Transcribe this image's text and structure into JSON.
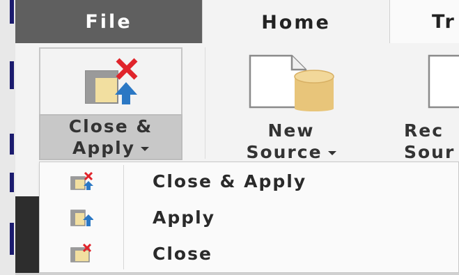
{
  "tabs": [
    {
      "label": "File",
      "active": false
    },
    {
      "label": "Home",
      "active": true
    },
    {
      "label": "Tr",
      "active": false
    }
  ],
  "ribbon": {
    "close_apply": {
      "line1": "Close &",
      "line2": "Apply",
      "icon": "close-apply-icon",
      "has_dropdown": true
    },
    "new_source": {
      "line1": "New",
      "line2": "Source",
      "icon": "new-source-icon",
      "has_dropdown": true
    },
    "recent_sources": {
      "line1": "Rec",
      "line2": "Sour",
      "icon": "recent-sources-icon"
    }
  },
  "menu": {
    "items": [
      {
        "label": "Close & Apply",
        "icon": "close-apply-icon"
      },
      {
        "label": "Apply",
        "icon": "apply-icon"
      },
      {
        "label": "Close",
        "icon": "close-icon"
      }
    ]
  },
  "colors": {
    "file_tab_bg": "#5f5f5f",
    "close_red": "#e0242b",
    "apply_blue": "#2b78c4",
    "table_yellow": "#f2dfa0",
    "db_gold": "#e8c57a"
  }
}
